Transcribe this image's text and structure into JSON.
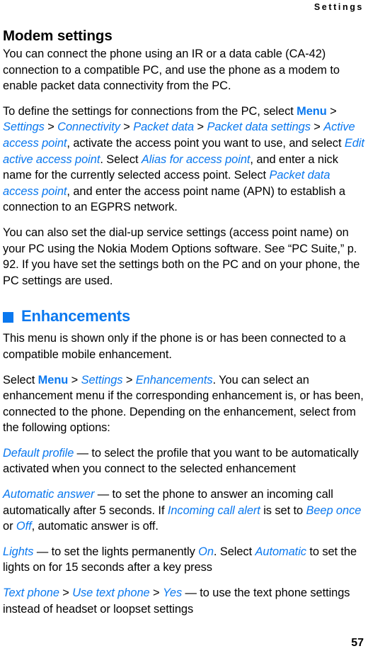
{
  "header": {
    "running_title": "Settings"
  },
  "sections": [
    {
      "id": "modem-settings",
      "heading": "Modem settings",
      "heading_style": "sub",
      "paragraphs": [
        {
          "id": "modem-intro",
          "runs": [
            {
              "type": "text",
              "text": "You can connect the phone using an IR or a data cable (CA-42) connection to a compatible PC, and use the phone as a modem to enable packet data connectivity from the PC."
            }
          ]
        },
        {
          "id": "modem-define",
          "runs": [
            {
              "type": "text",
              "text": "To define the settings for connections from the PC, select "
            },
            {
              "type": "menu",
              "text": "Menu"
            },
            {
              "type": "sep",
              "text": " > "
            },
            {
              "type": "item",
              "text": "Settings"
            },
            {
              "type": "sep",
              "text": " > "
            },
            {
              "type": "item",
              "text": "Connectivity"
            },
            {
              "type": "sep",
              "text": " > "
            },
            {
              "type": "item",
              "text": "Packet data"
            },
            {
              "type": "sep",
              "text": " > "
            },
            {
              "type": "item",
              "text": "Packet data settings"
            },
            {
              "type": "sep",
              "text": " > "
            },
            {
              "type": "item",
              "text": "Active access point"
            },
            {
              "type": "text",
              "text": ", activate the access point you want to use, and select "
            },
            {
              "type": "item",
              "text": "Edit active access point"
            },
            {
              "type": "text",
              "text": ". Select "
            },
            {
              "type": "item",
              "text": "Alias for access point"
            },
            {
              "type": "text",
              "text": ", and enter a nick name for the currently selected access point. Select "
            },
            {
              "type": "item",
              "text": "Packet data access point"
            },
            {
              "type": "text",
              "text": ", and enter the access point name (APN) to establish a connection to an EGPRS network."
            }
          ]
        },
        {
          "id": "modem-dialup",
          "runs": [
            {
              "type": "text",
              "text": "You can also set the dial-up service settings (access point name) on your PC using the Nokia Modem Options software. See “PC Suite,” p. 92. If you have set the settings both on the PC and on your phone, the PC settings are used."
            }
          ]
        }
      ]
    },
    {
      "id": "enhancements",
      "heading": "Enhancements",
      "heading_style": "main",
      "bullet_color": "#0a78ef",
      "paragraphs": [
        {
          "id": "enh-intro",
          "runs": [
            {
              "type": "text",
              "text": "This menu is shown only if the phone is or has been connected to a compatible mobile enhancement."
            }
          ]
        },
        {
          "id": "enh-select",
          "runs": [
            {
              "type": "text",
              "text": "Select "
            },
            {
              "type": "menu",
              "text": "Menu"
            },
            {
              "type": "sep",
              "text": " > "
            },
            {
              "type": "item",
              "text": "Settings"
            },
            {
              "type": "sep",
              "text": " > "
            },
            {
              "type": "item",
              "text": "Enhancements"
            },
            {
              "type": "text",
              "text": ". You can select an enhancement menu if the corresponding enhancement is, or has been, connected to the phone. Depending on the enhancement, select from the following options:"
            }
          ]
        },
        {
          "id": "opt-default-profile",
          "runs": [
            {
              "type": "item",
              "text": "Default profile"
            },
            {
              "type": "text",
              "text": " — to select the profile that you want to be automatically activated when you connect to the selected enhancement"
            }
          ]
        },
        {
          "id": "opt-automatic-answer",
          "runs": [
            {
              "type": "item",
              "text": "Automatic answer"
            },
            {
              "type": "text",
              "text": " — to set the phone to answer an incoming call automatically after 5 seconds. If "
            },
            {
              "type": "item",
              "text": "Incoming call alert"
            },
            {
              "type": "text",
              "text": " is set to "
            },
            {
              "type": "item",
              "text": "Beep once"
            },
            {
              "type": "text",
              "text": " or "
            },
            {
              "type": "item",
              "text": "Off"
            },
            {
              "type": "text",
              "text": ", automatic answer is off."
            }
          ]
        },
        {
          "id": "opt-lights",
          "runs": [
            {
              "type": "item",
              "text": "Lights"
            },
            {
              "type": "text",
              "text": " — to set the lights permanently "
            },
            {
              "type": "item",
              "text": "On"
            },
            {
              "type": "text",
              "text": ". Select "
            },
            {
              "type": "item",
              "text": "Automatic"
            },
            {
              "type": "text",
              "text": " to set the lights on for 15 seconds after a key press"
            }
          ]
        },
        {
          "id": "opt-text-phone",
          "runs": [
            {
              "type": "item",
              "text": "Text phone"
            },
            {
              "type": "sep",
              "text": " > "
            },
            {
              "type": "item",
              "text": "Use text phone"
            },
            {
              "type": "sep",
              "text": " > "
            },
            {
              "type": "item",
              "text": "Yes"
            },
            {
              "type": "text",
              "text": " — to use the text phone settings instead of headset or loopset settings"
            }
          ]
        }
      ]
    }
  ],
  "footer": {
    "page_number": "57"
  }
}
